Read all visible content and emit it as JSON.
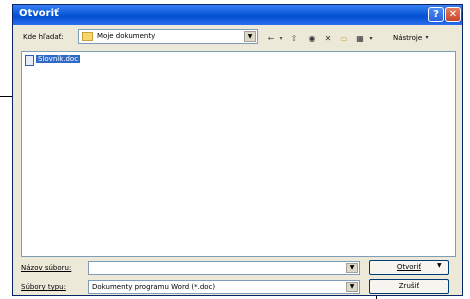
{
  "window": {
    "title": "Otvoriť",
    "help_glyph": "?",
    "close_glyph": "✕"
  },
  "toolbar": {
    "look_in_label": "Kde hľadať:",
    "look_in_value": "Moje dokumenty",
    "icons": [
      "back-icon",
      "up-folder-icon",
      "search-web-icon",
      "delete-icon",
      "new-folder-icon",
      "views-icon"
    ],
    "tools_label": "Nástroje"
  },
  "files": [
    {
      "name": "Slovník.doc",
      "selected": true
    }
  ],
  "form": {
    "filename_label": "Názov súboru:",
    "filename_value": "",
    "filetype_label": "Súbory typu:",
    "filetype_value": "Dokumenty programu Word (*.doc)"
  },
  "buttons": {
    "open_label": "Otvoriť",
    "cancel_label": "Zrušiť"
  }
}
